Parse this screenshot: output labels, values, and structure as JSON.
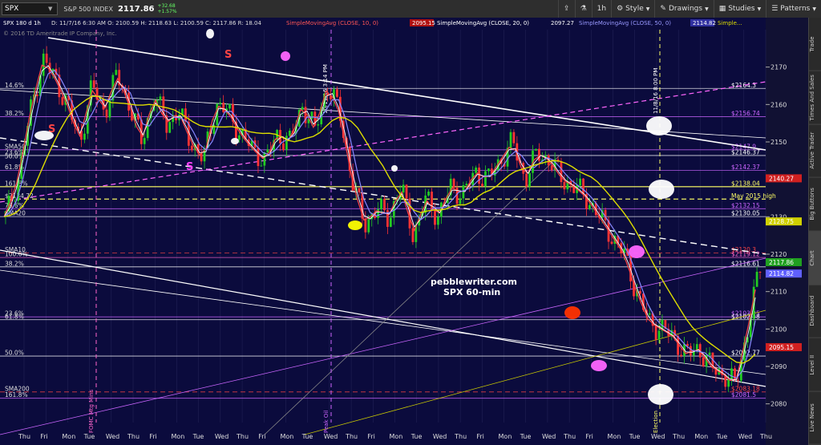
{
  "toolbar": {
    "symbol": "SPX",
    "description": "S&P 500 INDEX",
    "last_price": "2117.86",
    "change_abs": "+32.68",
    "change_pct": "+1.57%",
    "interval": "1h",
    "style_label": "Style",
    "drawings_label": "Drawings",
    "studies_label": "Studies",
    "patterns_label": "Patterns"
  },
  "header": {
    "chart_label": "SPX 180 d 1h",
    "ohlc": "D: 11/7/16 6:30 AM   O: 2100.59   H: 2118.63   L: 2100.59   C: 2117.86   R: 18.04",
    "sma10_label": "SimpleMovingAvg (CLOSE, 10, 0)",
    "sma10_value": "2095.15",
    "sma20_label": "SimpleMovingAvg (CLOSE, 20, 0)",
    "sma20_value": "2097.27",
    "sma50_label": "SimpleMovingAvg (CLOSE, 50, 0)",
    "sma50_value": "2114.82",
    "sma200_label": "Simple...",
    "copyright": "© 2016 TD Ameritrade IP Company, Inc.",
    "sma10_color": "#ff4444",
    "sma20_color": "#ffffff",
    "sma50_color": "#8888ff",
    "sma200_color": "#dddd00"
  },
  "sidebar": {
    "tabs": [
      "Trade",
      "Times And Sales",
      "Active Trader",
      "Big Buttons",
      "Chart",
      "Dashboard",
      "Level II",
      "Live News"
    ]
  },
  "chart_data": {
    "type": "candlestick",
    "title": "SPX 60-min",
    "watermark": "pebblewriter.com",
    "ylim": [
      2075,
      2180
    ],
    "y_ticks": [
      2080,
      2090,
      2100,
      2110,
      2120,
      2130,
      2140,
      2150,
      2160,
      2170
    ],
    "x_labels": [
      "Thu",
      "Fri",
      "Mon",
      "Tue",
      "Wed",
      "Thu",
      "Fri",
      "Mon",
      "Tue",
      "Wed",
      "Thu",
      "Fri",
      "Mon",
      "Tue",
      "Wed",
      "Thu",
      "Fri",
      "Mon",
      "Tue",
      "Wed",
      "Thu",
      "Fri",
      "Mon",
      "Tue",
      "Wed",
      "Thu",
      "Fri",
      "Mon",
      "Tue",
      "Wed",
      "Thu",
      "Mon",
      "Tue",
      "Wed",
      "Thu"
    ],
    "levels": [
      {
        "label": "$2164.3",
        "value": 2164.3,
        "color": "#ffffff"
      },
      {
        "label": "$2156.74",
        "value": 2156.74,
        "color": "#cc66ff"
      },
      {
        "label": "$2147.9",
        "value": 2147.9,
        "color": "#cc66ff"
      },
      {
        "label": "$2146.37",
        "value": 2146.37,
        "color": "#ffffff"
      },
      {
        "label": "$2142.37",
        "value": 2142.37,
        "color": "#cc66ff"
      },
      {
        "label": "$2138.04",
        "value": 2138.04,
        "color": "#ffff66"
      },
      {
        "label": "May 2015 high",
        "value": 2134.72,
        "color": "#ffff66"
      },
      {
        "label": "$2132.15",
        "value": 2132.15,
        "color": "#cc66ff"
      },
      {
        "label": "$2130.05",
        "value": 2130.05,
        "color": "#ffffff"
      },
      {
        "label": "$2120.3",
        "value": 2120.3,
        "color": "#ff4444"
      },
      {
        "label": "$2119.12",
        "value": 2119.12,
        "color": "#ff66cc"
      },
      {
        "label": "$2116.61",
        "value": 2116.61,
        "color": "#ffffff"
      },
      {
        "label": "$2103.25",
        "value": 2103.25,
        "color": "#cc66ff"
      },
      {
        "label": "$2102.48",
        "value": 2102.48,
        "color": "#ffffff"
      },
      {
        "label": "$2092.77",
        "value": 2092.77,
        "color": "#ffffff"
      },
      {
        "label": "$2083.18",
        "value": 2083.18,
        "color": "#ff4444"
      },
      {
        "label": "$2081.5",
        "value": 2081.5,
        "color": "#cc66ff"
      }
    ],
    "left_labels": [
      {
        "label": "14.6%",
        "value": 2164.3
      },
      {
        "label": "38.2%",
        "value": 2156.74
      },
      {
        "label": "SMA50",
        "value": 2147.9
      },
      {
        "label": "23.6%",
        "value": 2146.37
      },
      {
        "label": "50.0%",
        "value": 2145.3
      },
      {
        "label": "61.8%",
        "value": 2142.37
      },
      {
        "label": "161.8%",
        "value": 2138.04
      },
      {
        "label": "$2134.72",
        "value": 2134.72
      },
      {
        "label": "78.6%",
        "value": 2132.15
      },
      {
        "label": "SMA20",
        "value": 2130.05
      },
      {
        "label": "SMA10",
        "value": 2120.3
      },
      {
        "label": "100.0%",
        "value": 2119.12
      },
      {
        "label": "38.2%",
        "value": 2116.61
      },
      {
        "label": "23.6%",
        "value": 2103.25
      },
      {
        "label": "61.8%",
        "value": 2102.48
      },
      {
        "label": "50.0%",
        "value": 2092.77
      },
      {
        "label": "SMA200",
        "value": 2083.18
      },
      {
        "label": "161.8%",
        "value": 2081.5
      }
    ],
    "price_tags": [
      {
        "label": "2140.27",
        "value": 2140.27,
        "color": "#d02020"
      },
      {
        "label": "2128.75",
        "value": 2128.75,
        "color": "#d0d000"
      },
      {
        "label": "2117.86",
        "value": 2117.86,
        "color": "#20a020"
      },
      {
        "label": "2114.82",
        "value": 2114.82,
        "color": "#6060ff"
      },
      {
        "label": "2095.15",
        "value": 2095.15,
        "color": "#d02020"
      }
    ],
    "event_labels": [
      {
        "label": "10/11/16 3:14 PM",
        "index": 37
      },
      {
        "label": "11/8/16 8:00 PM",
        "index": 85
      }
    ],
    "bottom_event_labels": [
      "FOMC Mtg Mins",
      "Peak Oil",
      "Election"
    ],
    "wave_labels": [
      "S",
      "S",
      "S"
    ],
    "close_path": [
      2130,
      2140,
      2158,
      2172,
      2167,
      2160,
      2150,
      2165,
      2158,
      2168,
      2160,
      2150,
      2162,
      2155,
      2158,
      2150,
      2145,
      2160,
      2158,
      2152,
      2148,
      2145,
      2152,
      2150,
      2160,
      2153,
      2165,
      2158,
      2140,
      2128,
      2132,
      2130,
      2138,
      2125,
      2135,
      2130,
      2138,
      2136,
      2142,
      2140,
      2145,
      2150,
      2140,
      2147,
      2145,
      2140,
      2138,
      2135,
      2130,
      2125,
      2120,
      2110,
      2102,
      2100,
      2098,
      2093,
      2095,
      2090,
      2088,
      2085,
      2100,
      2117
    ]
  }
}
